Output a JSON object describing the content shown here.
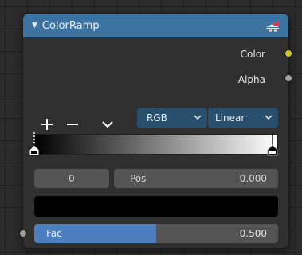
{
  "node": {
    "title": "ColorRamp",
    "outputs": [
      {
        "label": "Color",
        "socket_color": "#c7c729"
      },
      {
        "label": "Alpha",
        "socket_color": "#a1a1a1"
      }
    ],
    "toolbar": {
      "add_symbol": "+",
      "remove_symbol": "−",
      "color_mode": "RGB",
      "interpolation": "Linear"
    },
    "ramp": {
      "start_color": "#000000",
      "end_color": "#ffffff",
      "stops": [
        0.0,
        1.0
      ]
    },
    "active_stop_index": "0",
    "pos_label": "Pos",
    "pos_value": "0.000",
    "active_color": "#000000",
    "fac": {
      "label": "Fac",
      "value": "0.500",
      "fraction": 0.5,
      "socket_color": "#a1a1a1"
    },
    "colors": {
      "header": "#3d73a0",
      "dropdown": "#284f6d",
      "slider_fill": "#4d7ebf"
    }
  }
}
